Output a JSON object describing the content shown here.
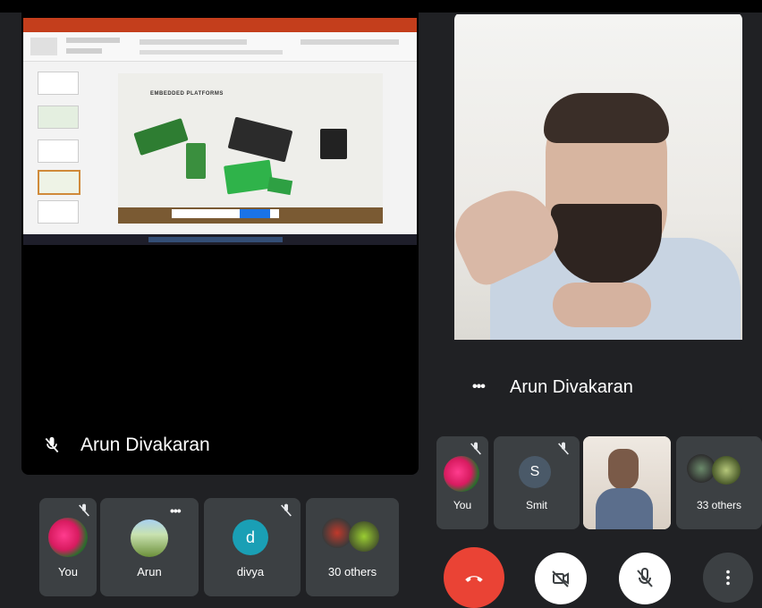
{
  "main_tile": {
    "speaker_name": "Arun Divakaran",
    "slide": {
      "title": "EMBEDDED PLATFORMS"
    }
  },
  "pinned_tile": {
    "speaker_name": "Arun Divakaran",
    "more_glyph": "•••"
  },
  "left_strip": [
    {
      "label": "You",
      "avatar": "flower-avatar",
      "muted": true
    },
    {
      "label": "Arun",
      "avatar": "outdoor-photo-avatar",
      "more": "•••"
    },
    {
      "label": "divya",
      "initial": "d",
      "color": "#1a9fb5",
      "muted": true
    },
    {
      "label": "30 others",
      "avatar": "group-avatars"
    }
  ],
  "right_strip": [
    {
      "label": "You",
      "avatar": "flower-avatar",
      "muted": true
    },
    {
      "label": "Smit",
      "initial": "S",
      "color": "#4a5968",
      "muted": true
    },
    {
      "label": "",
      "avatar": "camera-feed"
    },
    {
      "label": "33 others",
      "avatar": "group-avatars"
    }
  ],
  "controls": {
    "end_call": "end-call",
    "camera": "camera-off",
    "mic": "mic-off",
    "more": "more-options"
  },
  "colors": {
    "background": "#202124",
    "tile": "#3c4043",
    "end_call": "#ea4335"
  }
}
